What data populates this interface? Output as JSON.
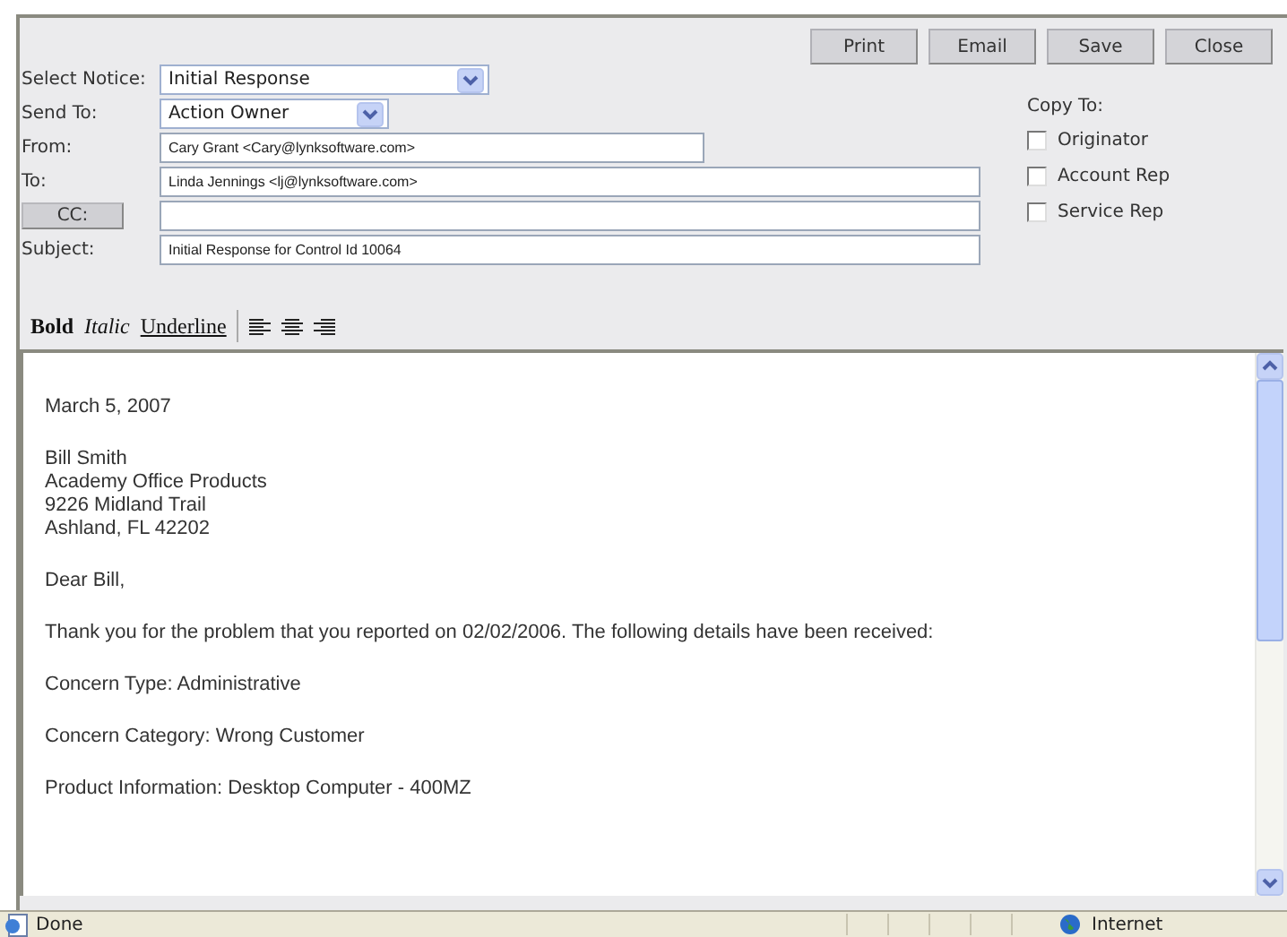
{
  "buttons": [
    "Print",
    "Email",
    "Save",
    "Close"
  ],
  "form": {
    "select_notice": {
      "label": "Select Notice:",
      "value": "Initial Response"
    },
    "send_to": {
      "label": "Send To:",
      "value": "Action Owner"
    },
    "from": {
      "label": "From:",
      "value": "Cary Grant <Cary@lynksoftware.com>"
    },
    "to": {
      "label": "To:",
      "value": "Linda Jennings <lj@lynksoftware.com>"
    },
    "cc": {
      "label": "CC:"
    },
    "subject": {
      "label": "Subject:",
      "value": "Initial Response for Control Id 10064"
    }
  },
  "copy_to": {
    "label": "Copy To:",
    "options": [
      {
        "label": "Originator",
        "checked": false
      },
      {
        "label": "Account Rep",
        "checked": false
      },
      {
        "label": "Service Rep",
        "checked": false
      }
    ]
  },
  "toolbar": [
    "Bold",
    "Italic",
    "Underline"
  ],
  "letter": [
    [
      "March 5, 2007"
    ],
    [
      "Bill Smith",
      "Academy Office Products",
      "9226 Midland Trail",
      "Ashland, FL 42202"
    ],
    [
      "Dear Bill,"
    ],
    [
      "Thank you for the problem that you reported on 02/02/2006.  The following details have been received:"
    ],
    [
      "Concern Type: Administrative"
    ],
    [
      "Concern Category: Wrong Customer"
    ],
    [
      "Product Information: Desktop Computer - 400MZ"
    ]
  ],
  "status_bar": {
    "left": "Done",
    "zone": "Internet"
  }
}
